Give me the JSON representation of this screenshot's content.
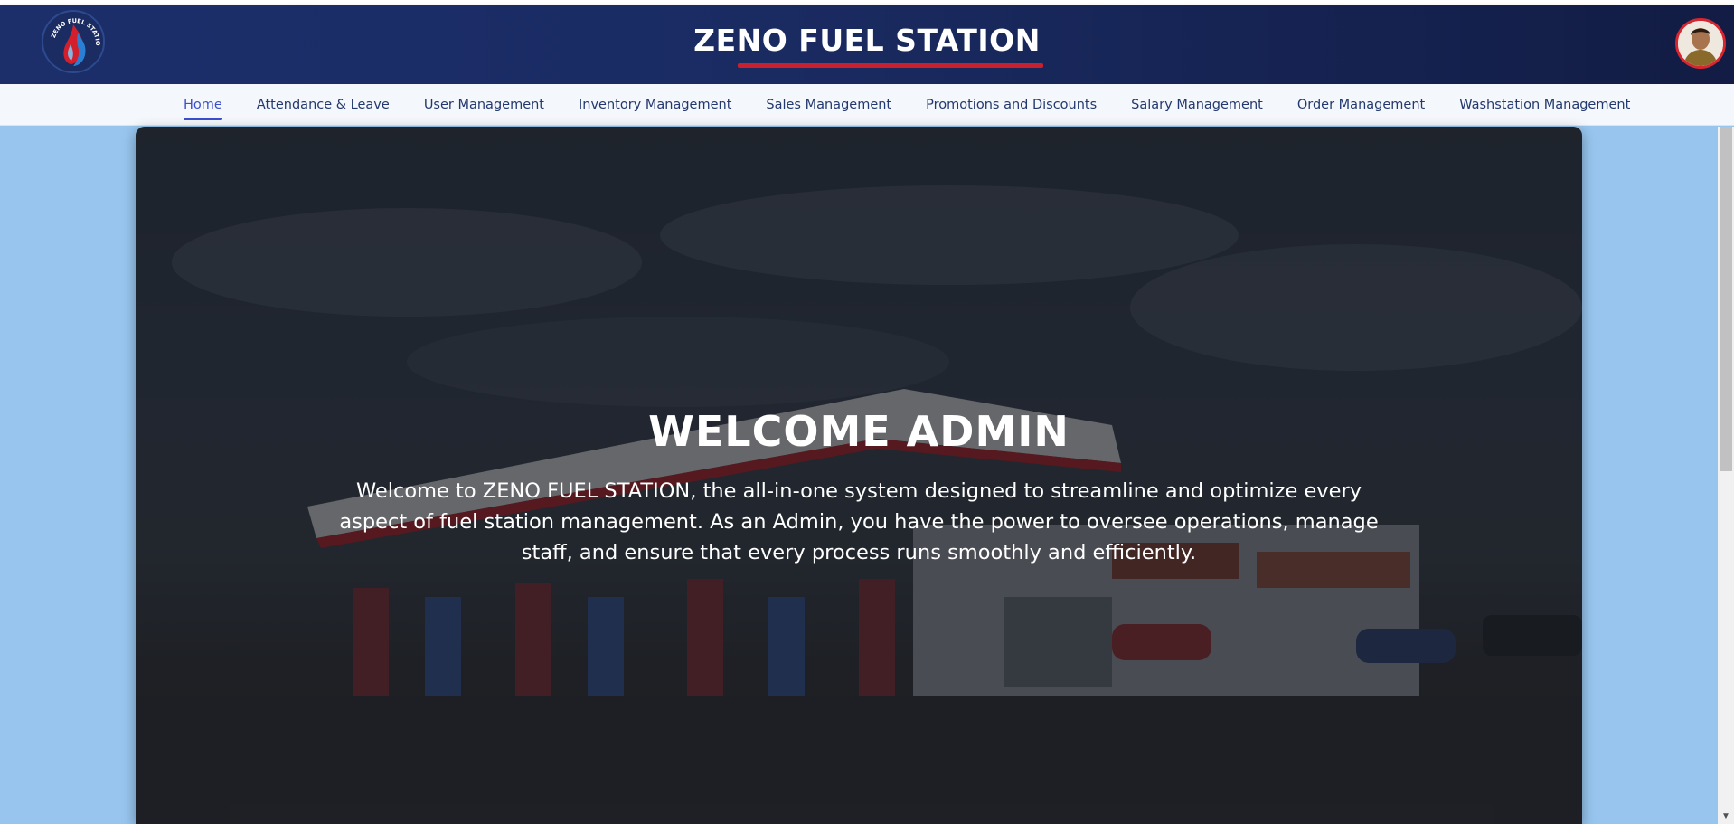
{
  "header": {
    "title": "ZENO FUEL STATION",
    "logo_text": "ZENO FUEL STATION",
    "colors": {
      "header_bg": "#1c2f6b",
      "accent_red": "#c8202e",
      "nav_active": "#3a4fd0"
    }
  },
  "nav": {
    "items": [
      {
        "label": "Home",
        "active": true
      },
      {
        "label": "Attendance & Leave"
      },
      {
        "label": "User Management"
      },
      {
        "label": "Inventory Management"
      },
      {
        "label": "Sales Management"
      },
      {
        "label": "Promotions and Discounts"
      },
      {
        "label": "Salary Management"
      },
      {
        "label": "Order Management"
      },
      {
        "label": "Washstation Management"
      }
    ]
  },
  "hero": {
    "title": "WELCOME ADMIN",
    "text": "Welcome to ZENO FUEL STATION, the all-in-one system designed to streamline and optimize every aspect of fuel station management. As an Admin, you have the power to oversee operations, manage staff, and ensure that every process runs smoothly and efficiently."
  },
  "icons": {
    "logo": "fuel-flame-logo-icon",
    "avatar": "user-avatar-icon",
    "scroll_down": "chevron-down-icon"
  }
}
